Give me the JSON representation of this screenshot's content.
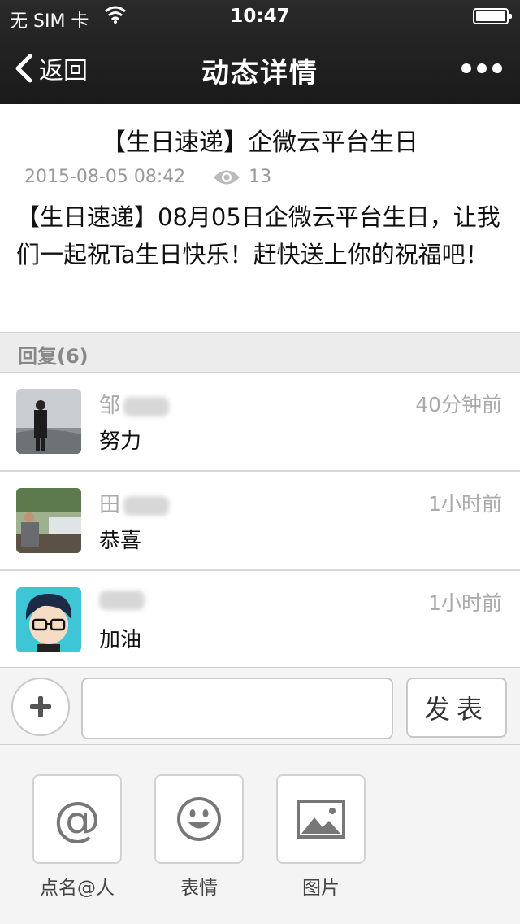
{
  "status_bar": {
    "carrier": "无 SIM 卡",
    "time": "10:47"
  },
  "nav": {
    "back_label": "返回",
    "title": "动态详情"
  },
  "post": {
    "title": "【生日速递】企微云平台生日",
    "date": "2015-08-05 08:42",
    "views": "13",
    "content": "【生日速递】08月05日企微云平台生日，让我们一起祝Ta生日快乐！赶快送上你的祝福吧！"
  },
  "replies": {
    "header": "回复(6)",
    "items": [
      {
        "name": "邹",
        "time": "40分钟前",
        "text": "努力"
      },
      {
        "name": "田",
        "time": "1小时前",
        "text": "恭喜"
      },
      {
        "name": "",
        "time": "1小时前",
        "text": "加油"
      }
    ]
  },
  "input_bar": {
    "placeholder": "",
    "send_label": "发表"
  },
  "tools": [
    {
      "label": "点名@人",
      "icon": "at-icon"
    },
    {
      "label": "表情",
      "icon": "smiley-icon"
    },
    {
      "label": "图片",
      "icon": "image-icon"
    }
  ]
}
